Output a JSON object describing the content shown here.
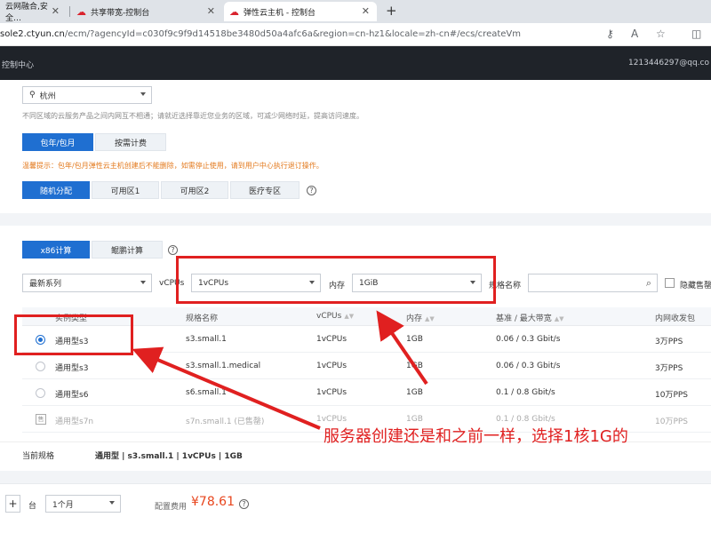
{
  "browser": {
    "tabs": [
      {
        "label": "云网融合,安全…"
      },
      {
        "label": "共享带宽-控制台"
      },
      {
        "label": "弹性云主机 - 控制台"
      }
    ],
    "url_host": "sole2.ctyun.cn",
    "url_rest": "/ecm/?agencyId=c030f9c9f9d14518be3480d50a4afc6a&region=cn-hz1&locale=zh-cn#/ecs/createVm"
  },
  "console": {
    "title": "控制中心",
    "user": "1213446297@qq.co"
  },
  "region": {
    "selected": "杭州",
    "hint": "不同区域的云服务产品之间内网互不相通；请就近选择靠近您业务的区域，可减少网络时延，提高访问速度。"
  },
  "billing": {
    "options": [
      "包年/包月",
      "按需计费"
    ],
    "selected": "包年/包月",
    "warning": "温馨提示：包年/包月弹性云主机创建后不能删除，如需停止使用，请到用户中心执行退订操作。"
  },
  "zones": {
    "options": [
      "随机分配",
      "可用区1",
      "可用区2",
      "医疗专区"
    ],
    "selected": "随机分配"
  },
  "arch": {
    "options": [
      "x86计算",
      "鲲鹏计算"
    ],
    "selected": "x86计算"
  },
  "filters": {
    "series": "最新系列",
    "vcpus_label": "vCPUs",
    "vcpus_value": "1vCPUs",
    "memory_label": "内存",
    "memory_value": "1GiB",
    "spec_name_label": "规格名称",
    "hide_soldout_label": "隐藏售罄"
  },
  "table": {
    "columns": [
      "实例类型",
      "规格名称",
      "vCPUs",
      "内存",
      "基准 / 最大带宽",
      "内网收发包"
    ],
    "rows": [
      {
        "type": "通用型s3",
        "spec": "s3.small.1",
        "vcpus": "1vCPUs",
        "memory": "1GB",
        "bandwidth": "0.06 / 0.3 Gbit/s",
        "pps": "3万PPS",
        "state": "selected"
      },
      {
        "type": "通用型s3",
        "spec": "s3.small.1.medical",
        "vcpus": "1vCPUs",
        "memory": "1GB",
        "bandwidth": "0.06 / 0.3 Gbit/s",
        "pps": "3万PPS",
        "state": "normal"
      },
      {
        "type": "通用型s6",
        "spec": "s6.small.1",
        "vcpus": "1vCPUs",
        "memory": "1GB",
        "bandwidth": "0.1 / 0.8 Gbit/s",
        "pps": "10万PPS",
        "state": "normal"
      },
      {
        "type": "通用型s7n",
        "spec": "s7n.small.1 (已售罄)",
        "vcpus": "1vCPUs",
        "memory": "1GB",
        "bandwidth": "0.1 / 0.8 Gbit/s",
        "pps": "10万PPS",
        "state": "soldout"
      }
    ]
  },
  "summary": {
    "label": "当前规格",
    "value": "通用型 | s3.small.1 | 1vCPUs | 1GB"
  },
  "footer": {
    "quantity_unit": "台",
    "duration": "1个月",
    "price_label": "配置费用",
    "price": "¥78.61"
  },
  "annotation": {
    "text": "服务器创建还是和之前一样，选择1核1G的",
    "color": "#e02020"
  },
  "colors": {
    "primary": "#1f6fd1",
    "warning": "#e37a1e",
    "price": "#e8461e",
    "header_bg": "#1f2329"
  }
}
